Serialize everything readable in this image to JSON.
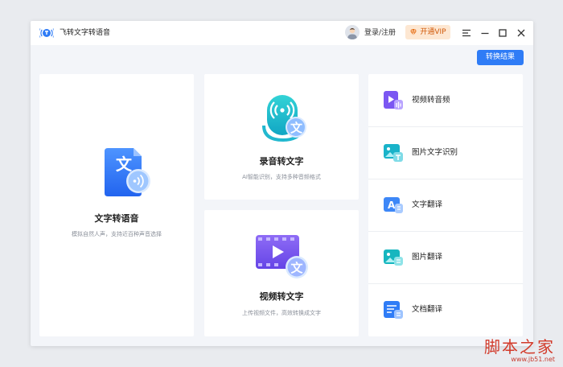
{
  "app": {
    "title": "飞转文字转语音"
  },
  "header": {
    "login_label": "登录/注册",
    "vip_label": "开通VIP"
  },
  "toolbar": {
    "convert_results_label": "转换结果"
  },
  "cards": {
    "tts": {
      "title": "文字转语音",
      "subtitle": "模拟自然人声，支持近百种声音选择",
      "icon_char": "文"
    },
    "rec": {
      "title": "录音转文字",
      "subtitle": "AI智能识别，支持多种音频格式",
      "icon_char": "文"
    },
    "video": {
      "title": "视频转文字",
      "subtitle": "上传视频文件，高效转换成文字",
      "icon_char": "文"
    }
  },
  "tools": [
    {
      "label": "视频转音频",
      "icon": "video-to-audio-icon"
    },
    {
      "label": "图片文字识别",
      "icon": "image-ocr-icon"
    },
    {
      "label": "文字翻译",
      "icon": "text-translate-icon"
    },
    {
      "label": "图片翻译",
      "icon": "image-translate-icon"
    },
    {
      "label": "文档翻译",
      "icon": "document-translate-icon"
    }
  ],
  "watermark": {
    "brand": "脚本之家",
    "url": "www.jb51.net"
  },
  "colors": {
    "accent": "#2f7cf6",
    "vip_bg": "#fde7d2",
    "vip_text": "#d15a0a",
    "watermark": "#d23a2a"
  }
}
